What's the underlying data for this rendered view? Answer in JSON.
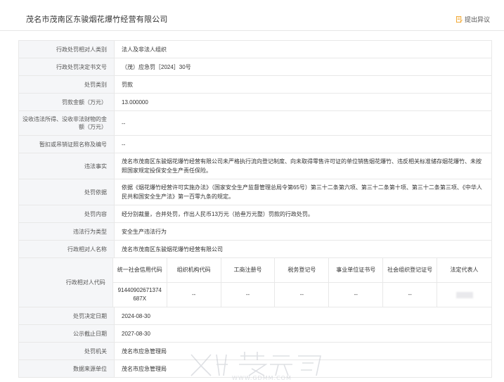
{
  "header": {
    "title": "茂名市茂南区东骏烟花爆竹经营有限公司",
    "objection_label": "提出异议"
  },
  "rows": {
    "r1": {
      "label": "行政处罚相对人类别",
      "value": "法人及非法人组织"
    },
    "r2": {
      "label": "行政处罚决定书文号",
      "value": "（茂）应急罚［2024］30号"
    },
    "r3": {
      "label": "处罚类别",
      "value": "罚款"
    },
    "r4": {
      "label": "罚款金额（万元）",
      "value": "13.000000"
    },
    "r5": {
      "label": "没收违法所得、没收非法财物的金额（万元）",
      "value": "--"
    },
    "r6": {
      "label": "暂扣或吊销证照名称及编号",
      "value": "--"
    },
    "r7": {
      "label": "违法事实",
      "value": "茂名市茂南区东骏烟花爆竹经营有限公司未严格执行流向登记制度、向未取得零售许可证的单位销售烟花爆竹、违反相关标准储存烟花爆竹、未按照国家规定投保安全生产责任保险。"
    },
    "r8": {
      "label": "处罚依据",
      "value": "依据《烟花爆竹经营许可实施办法》（国家安全生产监督管理总局令第65号）第三十二条第六项、第三十二条第十项、第三十二条第三项、《中华人民共和国安全生产法》第一百零九条的规定。"
    },
    "r9": {
      "label": "处罚内容",
      "value": "经分别裁量，合并处罚，作出人民币13万元（拾叁万元整）罚款的行政处罚。"
    },
    "r10": {
      "label": "违法行为类型",
      "value": "安全生产违法行为"
    },
    "r11": {
      "label": "行政相对人名称",
      "value": "茂名市茂南区东骏烟花爆竹经营有限公司"
    },
    "r12": {
      "label": "行政相对人代码",
      "headers": [
        "统一社会信用代码",
        "组织机构代码",
        "工商注册号",
        "税务登记号",
        "事业单位证书号",
        "社会组织登记证号",
        "法定代表人"
      ],
      "values": [
        "91440902671374687X",
        "--",
        "--",
        "--",
        "--",
        "--",
        ""
      ]
    },
    "r13": {
      "label": "处罚决定日期",
      "value": "2024-08-30"
    },
    "r14": {
      "label": "公示截止日期",
      "value": "2027-08-30"
    },
    "r15": {
      "label": "处罚机关",
      "value": "茂名市应急管理局"
    },
    "r16": {
      "label": "数据来源单位",
      "value": "茂名市应急管理局"
    }
  },
  "watermark": {
    "text": "WWW.GDMM.COM"
  },
  "colors": {
    "label_bg": "#f5f6f8",
    "border": "#e8e8e8",
    "icon_orange": "#f0a020"
  }
}
